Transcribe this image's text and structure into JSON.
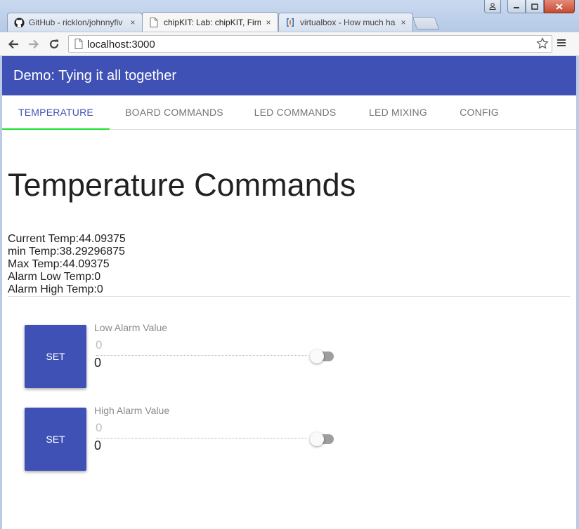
{
  "browser": {
    "tabs": [
      {
        "title": "GitHub - ricklon/johnnyfiv",
        "icon": "github-icon",
        "active": false
      },
      {
        "title": "chipKIT: Lab: chipKIT, Firm",
        "icon": "page-icon",
        "active": true
      },
      {
        "title": "virtualbox - How much ha",
        "icon": "serverfault-icon",
        "active": false
      }
    ],
    "tab_close_glyph": "×",
    "address": "localhost:3000"
  },
  "app": {
    "title": "Demo: Tying it all together",
    "tabs": [
      "TEMPERATURE",
      "BOARD COMMANDS",
      "LED COMMANDS",
      "LED MIXING",
      "CONFIG"
    ],
    "active_tab": "TEMPERATURE"
  },
  "temperature": {
    "heading": "Temperature Commands",
    "stats": [
      "Current Temp:44.09375",
      "min Temp:38.29296875",
      "Max Temp:44.09375",
      "Alarm Low Temp:0",
      "Alarm High Temp:0"
    ],
    "low_alarm": {
      "button": "SET",
      "label": "Low Alarm Value",
      "placeholder": "0",
      "value": "0",
      "toggle_on": false
    },
    "high_alarm": {
      "button": "SET",
      "label": "High Alarm Value",
      "placeholder": "0",
      "value": "0",
      "toggle_on": false
    }
  },
  "colors": {
    "primary": "#3f51b5",
    "tab_indicator": "#18e32b"
  }
}
